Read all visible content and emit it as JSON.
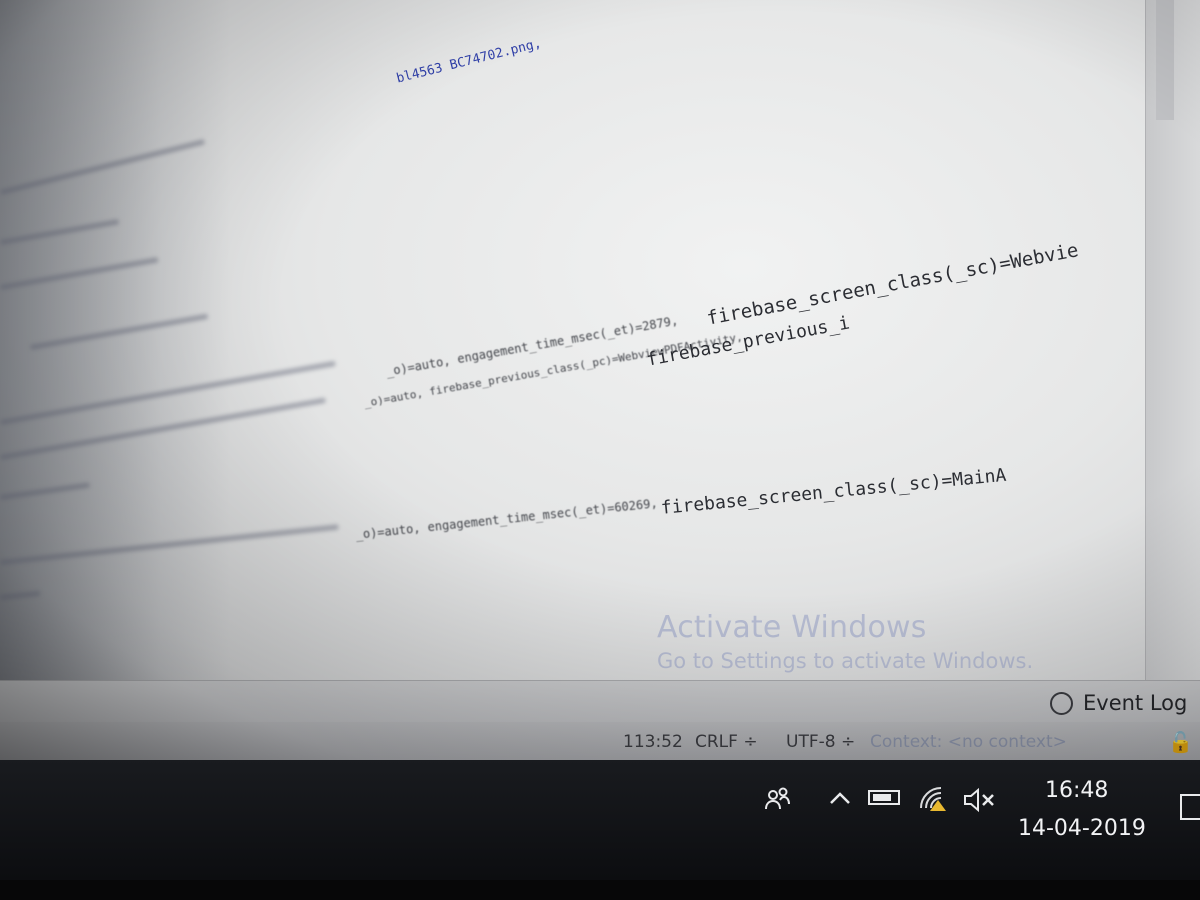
{
  "editor": {
    "lines": {
      "top_link": "bl4563 BC74702.png,",
      "line1_blur": "_o)=auto, engagement_time_msec(_et)=2879,",
      "line1_sharp": "firebase_screen_class(_sc)=Webvie",
      "line2_blur": "_o)=auto, firebase_previous_class(_pc)=WebviewPDFActivity,",
      "line2_sharp": "firebase_previous_i",
      "line3_blur": "_o)=auto, engagement_time_msec(_et)=60269,",
      "line3_sharp": "firebase_screen_class(_sc)=MainA"
    }
  },
  "watermark": {
    "title": "Activate Windows",
    "subtitle": "Go to Settings to activate Windows."
  },
  "event_bar": {
    "event_log_label": "Event Log"
  },
  "status_bar": {
    "position": "113:52",
    "line_separator": "CRLF ÷",
    "encoding": "UTF-8 ÷",
    "context": "Context: <no context>"
  },
  "taskbar": {
    "time": "16:48",
    "date": "14-04-2019",
    "icons": [
      "people-icon",
      "chevron-up-icon",
      "battery-icon",
      "wifi-icon",
      "volume-muted-icon",
      "notification-icon"
    ]
  },
  "colors": {
    "link": "#2f3fa8",
    "code_text": "#2b2d33",
    "watermark": "#b6bcd2",
    "taskbar": "#0c0d10"
  }
}
